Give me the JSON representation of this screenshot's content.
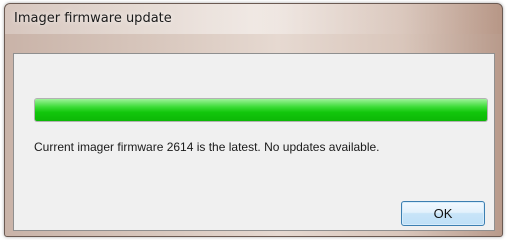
{
  "window": {
    "title": "Imager firmware update"
  },
  "progress": {
    "percent": 100,
    "fill_color": "#12c70c"
  },
  "message": {
    "text": "Current imager firmware 2614 is the latest. No updates available."
  },
  "buttons": {
    "ok_label": "OK"
  }
}
